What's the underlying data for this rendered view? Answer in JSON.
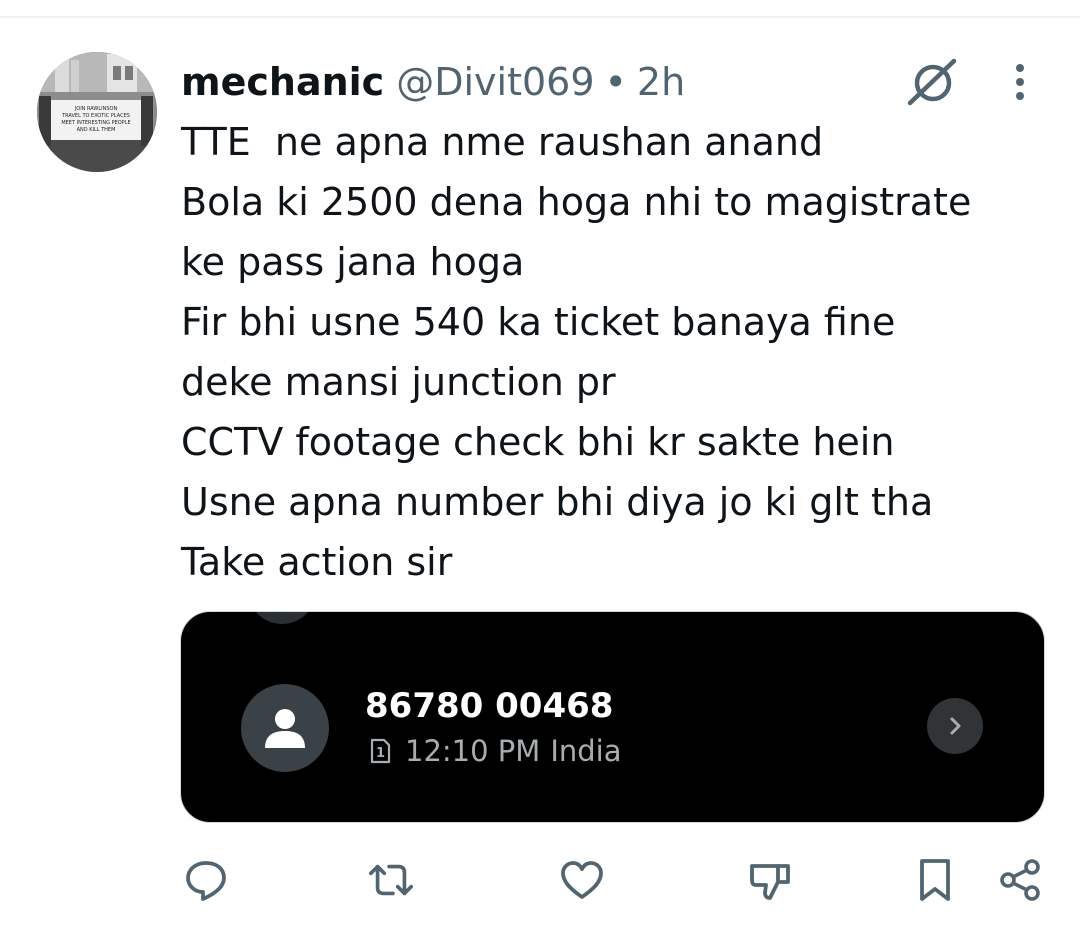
{
  "tweet": {
    "author_name": "mechanic",
    "author_handle": "@Divit069",
    "separator": "•",
    "time": "2h",
    "lines": [
      "TTE  ne apna nme raushan anand",
      "Bola ki 2500 dena hoga nhi to magistrate",
      "ke pass jana hoga",
      "Fir bhi usne 540 ka ticket banaya fine",
      "deke mansi junction pr",
      "CCTV footage check bhi kr sakte hein",
      "Usne apna number bhi diya jo ki glt tha",
      "Take action sir"
    ]
  },
  "avatar": {
    "banner_text": [
      "JOIN RAWLINSON",
      "TRAVEL TO EXOTIC PLACES",
      "MEET INTERESTING PEOPLE",
      "AND KILL THEM"
    ]
  },
  "media": {
    "phone_number": "86780 00468",
    "call_time": "12:10 PM",
    "call_location": "India",
    "sim_label": "1"
  },
  "icons": {
    "grok": "grok-icon",
    "more": "more-vertical-icon",
    "reply": "reply-icon",
    "repost": "repost-icon",
    "like": "like-icon",
    "dislike": "dislike-icon",
    "bookmark": "bookmark-icon",
    "share": "share-icon"
  },
  "colors": {
    "text_primary": "#0f1419",
    "text_secondary": "#536471",
    "media_background": "#000000",
    "media_text": "#ffffff",
    "media_subtext": "#a8adb1"
  }
}
